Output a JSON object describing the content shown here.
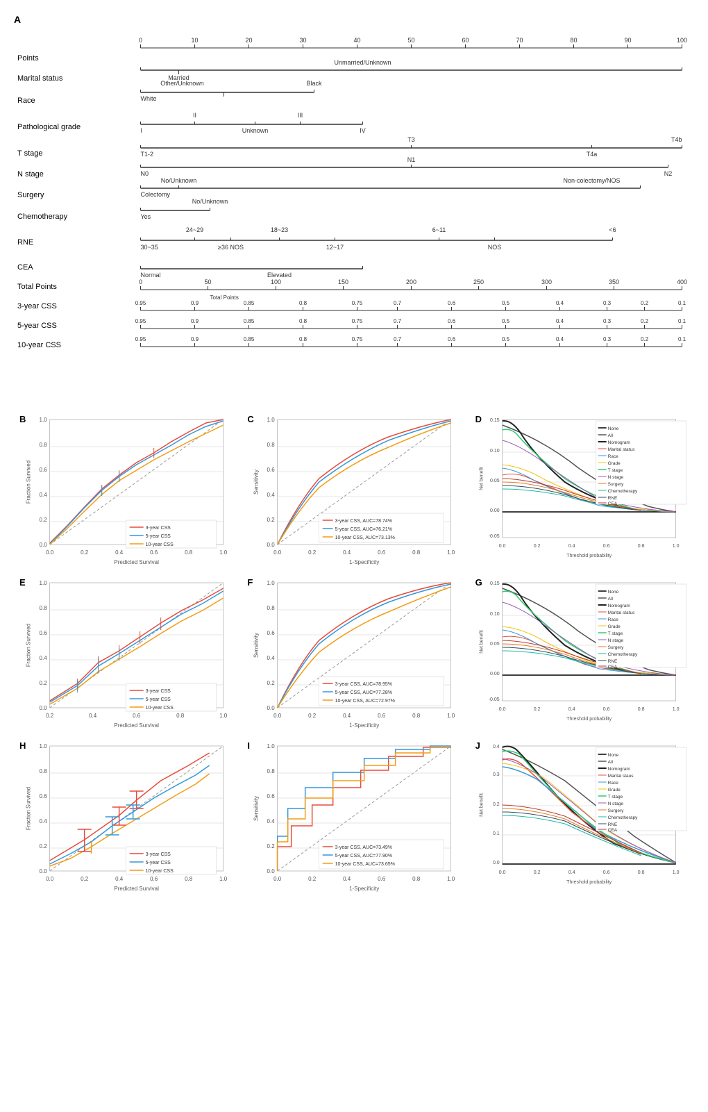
{
  "panelA": {
    "label": "A",
    "axisTitle": "Points",
    "axisTicks": [
      0,
      10,
      20,
      30,
      40,
      50,
      60,
      70,
      80,
      90,
      100
    ],
    "variables": [
      {
        "name": "Marital status",
        "categories": [
          "Unmarried/Unknown",
          "Married"
        ]
      },
      {
        "name": "Race",
        "categories": [
          "White",
          "Other/Unknown",
          "Black"
        ]
      },
      {
        "name": "Pathological grade",
        "categories": [
          "I",
          "II",
          "Unknown",
          "III",
          "IV"
        ]
      },
      {
        "name": "T stage",
        "categories": [
          "T1-2",
          "T3",
          "T4a",
          "T4b"
        ]
      },
      {
        "name": "N stage",
        "categories": [
          "N0",
          "N1",
          "N2"
        ]
      },
      {
        "name": "Surgery",
        "categories": [
          "Colectomy",
          "No/Unknown",
          "Non-colectomy/NOS"
        ]
      },
      {
        "name": "Chemotherapy",
        "categories": [
          "Yes",
          "No/Unknown"
        ]
      },
      {
        "name": "RNE",
        "categories": [
          "30~35",
          "24~29",
          ">=36 NOS",
          "18~23",
          "12~17",
          "6~11",
          "NOS",
          "<6"
        ]
      },
      {
        "name": "CEA",
        "categories": [
          "Normal",
          "Elevated"
        ]
      },
      {
        "name": "Total Points",
        "axisTicks": [
          0,
          50,
          100,
          150,
          200,
          250,
          300,
          350,
          400
        ]
      },
      {
        "name": "3-year CSS",
        "axisTicks": [
          0.95,
          0.9,
          0.85,
          0.8,
          0.75,
          0.7,
          0.6,
          0.5,
          0.4,
          0.3,
          0.2,
          0.1
        ]
      },
      {
        "name": "5-year CSS",
        "axisTicks": [
          0.95,
          0.9,
          0.85,
          0.8,
          0.75,
          0.7,
          0.6,
          0.5,
          0.4,
          0.3,
          0.2,
          0.1
        ]
      },
      {
        "name": "10-year CSS",
        "axisTicks": [
          0.95,
          0.9,
          0.85,
          0.8,
          0.75,
          0.7,
          0.6,
          0.5,
          0.4,
          0.3,
          0.2,
          0.1
        ]
      }
    ]
  },
  "panelB": {
    "label": "B",
    "xAxisLabel": "Predicted Survival",
    "yAxisLabel": "Fraction Survived",
    "legend": [
      {
        "label": "3-year CSS",
        "color": "#e74c3c"
      },
      {
        "label": "5-year CSS",
        "color": "#3498db"
      },
      {
        "label": "10-year CSS",
        "color": "#f39c12"
      }
    ]
  },
  "panelC": {
    "label": "C",
    "xAxisLabel": "1-Specificity",
    "yAxisLabel": "Sensitivity",
    "legend": [
      {
        "label": "3-year CSS, AUC=78.74%",
        "color": "#e74c3c"
      },
      {
        "label": "5-year CSS, AUC=76.21%",
        "color": "#3498db"
      },
      {
        "label": "10-year CSS, AUC=73.13%",
        "color": "#f39c12"
      }
    ]
  },
  "panelD": {
    "label": "D",
    "xAxisLabel": "Threshold probability",
    "yAxisLabel": "Net benefit",
    "legend": [
      {
        "label": "None",
        "color": "#000"
      },
      {
        "label": "All",
        "color": "#555"
      },
      {
        "label": "Nomogram",
        "color": "#222"
      },
      {
        "label": "Marital status",
        "color": "#e74c3c"
      },
      {
        "label": "Race",
        "color": "#3498db"
      },
      {
        "label": "Grade",
        "color": "#f1c40f"
      },
      {
        "label": "T stage",
        "color": "#2ecc71"
      },
      {
        "label": "N stage",
        "color": "#9b59b6"
      },
      {
        "label": "Surgery",
        "color": "#e67e22"
      },
      {
        "label": "Chemotherapy",
        "color": "#1abc9c"
      },
      {
        "label": "RNE",
        "color": "#34495e"
      },
      {
        "label": "CEA",
        "color": "#c0392b"
      }
    ]
  },
  "panelE": {
    "label": "E",
    "xAxisLabel": "Predicted Survival",
    "yAxisLabel": "Fraction Survived",
    "legend": [
      {
        "label": "3-year CSS",
        "color": "#e74c3c"
      },
      {
        "label": "5-year CSS",
        "color": "#3498db"
      },
      {
        "label": "10-year CSS",
        "color": "#f39c12"
      }
    ]
  },
  "panelF": {
    "label": "F",
    "xAxisLabel": "1-Specificity",
    "yAxisLabel": "Sensitivity",
    "legend": [
      {
        "label": "3-year CSS, AUC=78.95%",
        "color": "#e74c3c"
      },
      {
        "label": "5-year CSS, AUC=77.28%",
        "color": "#3498db"
      },
      {
        "label": "10-year CSS, AUC=72.97%",
        "color": "#f39c12"
      }
    ]
  },
  "panelG": {
    "label": "G",
    "xAxisLabel": "Threshold probability",
    "yAxisLabel": "Net benefit",
    "legend": [
      {
        "label": "None",
        "color": "#000"
      },
      {
        "label": "All",
        "color": "#555"
      },
      {
        "label": "Nomogram",
        "color": "#222"
      },
      {
        "label": "Marital status",
        "color": "#e74c3c"
      },
      {
        "label": "Race",
        "color": "#3498db"
      },
      {
        "label": "Grade",
        "color": "#f1c40f"
      },
      {
        "label": "T stage",
        "color": "#2ecc71"
      },
      {
        "label": "N stage",
        "color": "#9b59b6"
      },
      {
        "label": "Surgery",
        "color": "#e67e22"
      },
      {
        "label": "Chemotherapy",
        "color": "#1abc9c"
      },
      {
        "label": "RNE",
        "color": "#34495e"
      },
      {
        "label": "CEA",
        "color": "#c0392b"
      }
    ]
  },
  "panelH": {
    "label": "H",
    "xAxisLabel": "Predicted Survival",
    "yAxisLabel": "Fraction Survived",
    "legend": [
      {
        "label": "3-year CSS",
        "color": "#e74c3c"
      },
      {
        "label": "5-year CSS",
        "color": "#3498db"
      },
      {
        "label": "10-year CSS",
        "color": "#f39c12"
      }
    ]
  },
  "panelI": {
    "label": "I",
    "xAxisLabel": "1-Specificity",
    "yAxisLabel": "Sensitivity",
    "legend": [
      {
        "label": "3-year CSS, AUC=73.49%",
        "color": "#e74c3c"
      },
      {
        "label": "5-year CSS, AUC=77.90%",
        "color": "#3498db"
      },
      {
        "label": "10-year CSS, AUC=73.65%",
        "color": "#f39c12"
      }
    ]
  },
  "panelJ": {
    "label": "J",
    "xAxisLabel": "Threshold probability",
    "yAxisLabel": "Net benefit",
    "legend": [
      {
        "label": "None",
        "color": "#000"
      },
      {
        "label": "All",
        "color": "#555"
      },
      {
        "label": "Nomogram",
        "color": "#222"
      },
      {
        "label": "Marital staus",
        "color": "#e74c3c"
      },
      {
        "label": "Race",
        "color": "#3498db"
      },
      {
        "label": "Grade",
        "color": "#f1c40f"
      },
      {
        "label": "T stage",
        "color": "#2ecc71"
      },
      {
        "label": "N stage",
        "color": "#9b59b6"
      },
      {
        "label": "Surgery",
        "color": "#e67e22"
      },
      {
        "label": "Chemotherapy",
        "color": "#1abc9c"
      },
      {
        "label": "RNE",
        "color": "#34495e"
      },
      {
        "label": "CEA",
        "color": "#c0392b"
      }
    ]
  }
}
